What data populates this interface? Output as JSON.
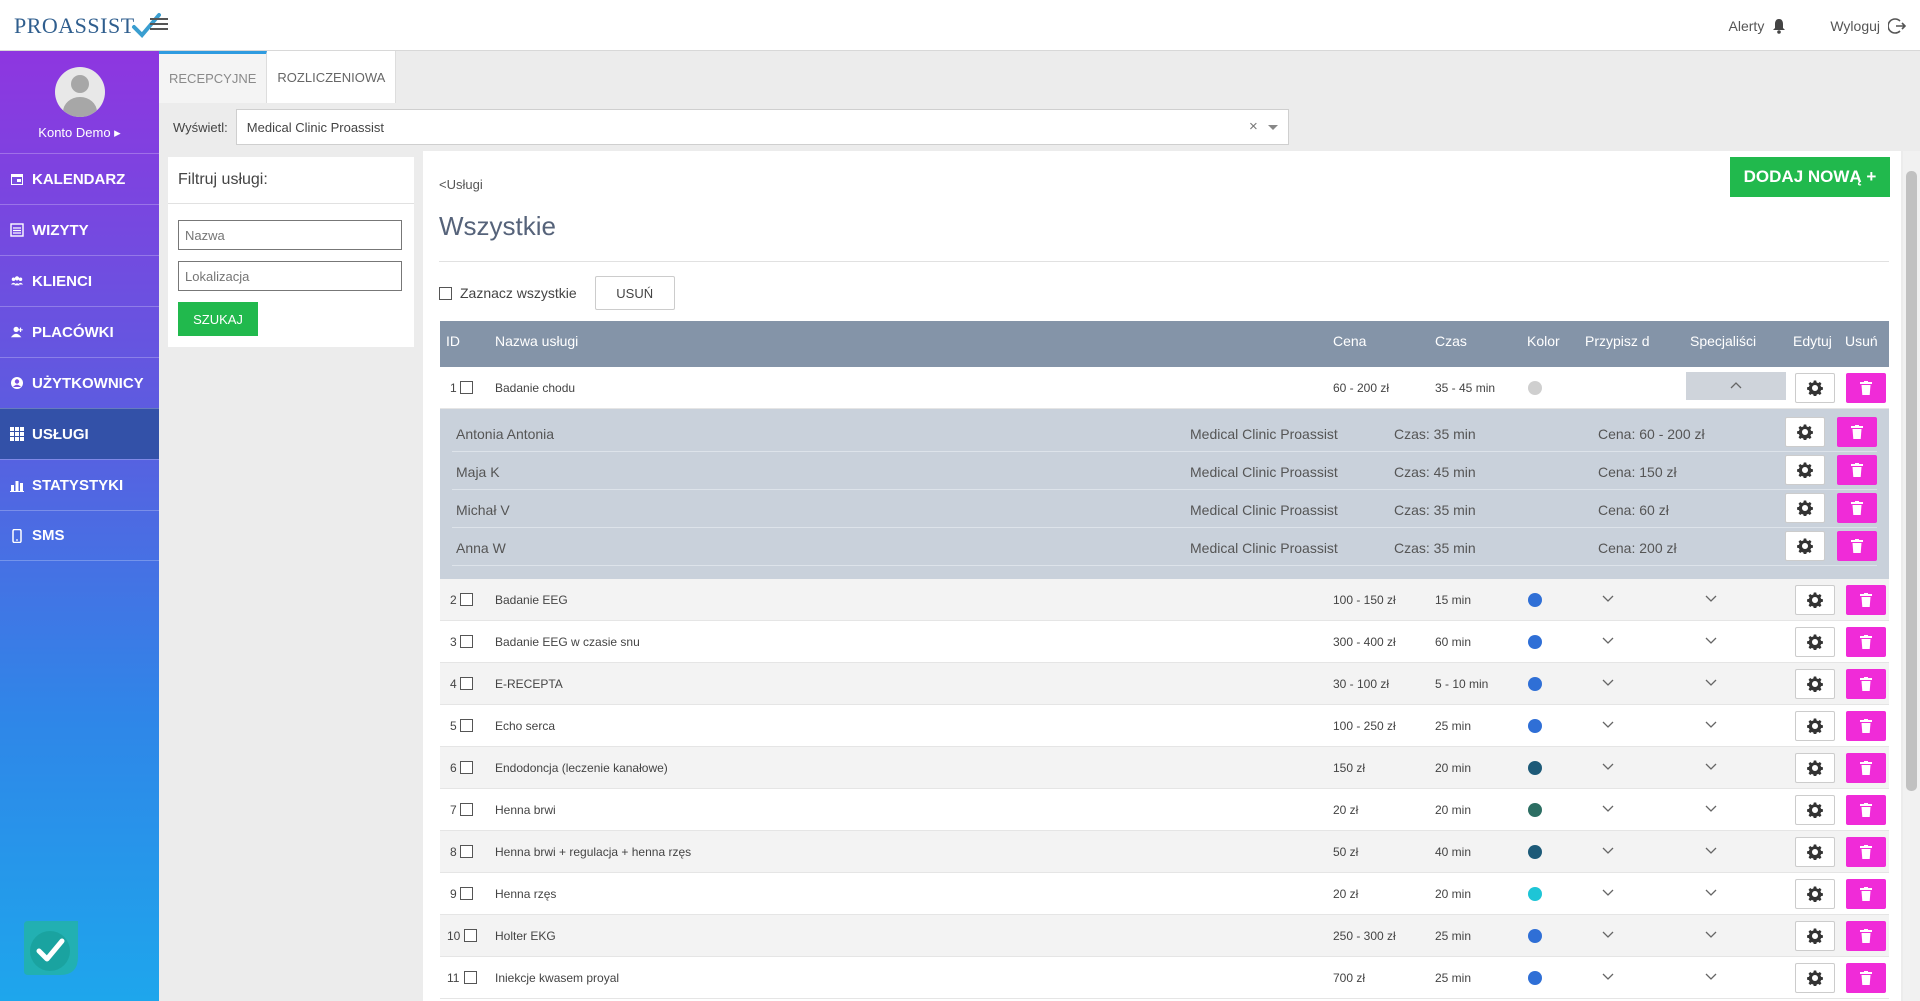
{
  "brand": {
    "logo_text": "PROASSIST",
    "accent": "#21b94d",
    "delete_color": "#f02bd8"
  },
  "topbar": {
    "alerts_label": "Alerty",
    "logout_label": "Wyloguj"
  },
  "profile": {
    "name": "Konto Demo ▸"
  },
  "sidebar": {
    "items": [
      {
        "label": "KALENDARZ",
        "icon": "calendar-icon"
      },
      {
        "label": "WIZYTY",
        "icon": "list-icon"
      },
      {
        "label": "KLIENCI",
        "icon": "users-icon"
      },
      {
        "label": "PLACÓWKI",
        "icon": "user-plus-icon"
      },
      {
        "label": "UŻYTKOWNICY",
        "icon": "user-circle-icon"
      },
      {
        "label": "USŁUGI",
        "icon": "grid-icon"
      },
      {
        "label": "STATYSTYKI",
        "icon": "bar-chart-icon"
      },
      {
        "label": "SMS",
        "icon": "phone-icon"
      }
    ]
  },
  "tabs": [
    "RECEPCYJNE",
    "ROZLICZENIOWA"
  ],
  "display": {
    "label": "Wyświetl:",
    "value": "Medical Clinic Proassist"
  },
  "filter": {
    "title": "Filtruj usługi:",
    "name_placeholder": "Nazwa",
    "location_placeholder": "Lokalizacja",
    "search_label": "SZUKAJ"
  },
  "main": {
    "breadcrumb": "<Usługi",
    "title": "Wszystkie",
    "add_label": "DODAJ NOWĄ +",
    "select_all_label": "Zaznacz wszystkie",
    "delete_label": "USUŃ"
  },
  "table": {
    "headers": {
      "id": "ID",
      "name": "Nazwa usługi",
      "price": "Cena",
      "time": "Czas",
      "color": "Kolor",
      "assign": "Przypisz d",
      "specialists": "Specjaliści",
      "edit": "Edytuj",
      "delete": "Usuń"
    },
    "rows": [
      {
        "id": "1",
        "name": "Badanie chodu",
        "price": "60 - 200 zł",
        "time": "35 - 45 min",
        "color": "#cfcfcf"
      },
      {
        "id": "2",
        "name": "Badanie EEG",
        "price": "100 - 150 zł",
        "time": "15 min",
        "color": "#2f6fd6"
      },
      {
        "id": "3",
        "name": "Badanie EEG w czasie snu",
        "price": "300 - 400 zł",
        "time": "60 min",
        "color": "#2f6fd6"
      },
      {
        "id": "4",
        "name": "E-RECEPTA",
        "price": "30 - 100 zł",
        "time": "5 - 10 min",
        "color": "#2f6fd6"
      },
      {
        "id": "5",
        "name": "Echo serca",
        "price": "100 - 250 zł",
        "time": "25 min",
        "color": "#2f6fd6"
      },
      {
        "id": "6",
        "name": "Endodoncja (leczenie kanałowe)",
        "price": "150 zł",
        "time": "20 min",
        "color": "#1d5a78"
      },
      {
        "id": "7",
        "name": "Henna brwi",
        "price": "20 zł",
        "time": "20 min",
        "color": "#2c6e63"
      },
      {
        "id": "8",
        "name": "Henna brwi + regulacja + henna rzęs",
        "price": "50 zł",
        "time": "40 min",
        "color": "#1d5a78"
      },
      {
        "id": "9",
        "name": "Henna rzęs",
        "price": "20 zł",
        "time": "20 min",
        "color": "#1ec5d6"
      },
      {
        "id": "10",
        "name": "Holter EKG",
        "price": "250 - 300 zł",
        "time": "25 min",
        "color": "#2f6fd6"
      },
      {
        "id": "11",
        "name": "Iniekcje kwasem proyal",
        "price": "700 zł",
        "time": "25 min",
        "color": "#2f6fd6"
      }
    ],
    "expanded": [
      {
        "name": "Antonia Antonia",
        "clinic": "Medical Clinic Proassist",
        "time": "Czas: 35 min",
        "price": "Cena: 60 - 200 zł"
      },
      {
        "name": "Maja K",
        "clinic": "Medical Clinic Proassist",
        "time": "Czas: 45 min",
        "price": "Cena: 150 zł"
      },
      {
        "name": "Michał V",
        "clinic": "Medical Clinic Proassist",
        "time": "Czas: 35 min",
        "price": "Cena: 60 zł"
      },
      {
        "name": "Anna W",
        "clinic": "Medical Clinic Proassist",
        "time": "Czas: 35 min",
        "price": "Cena: 200 zł"
      }
    ]
  }
}
